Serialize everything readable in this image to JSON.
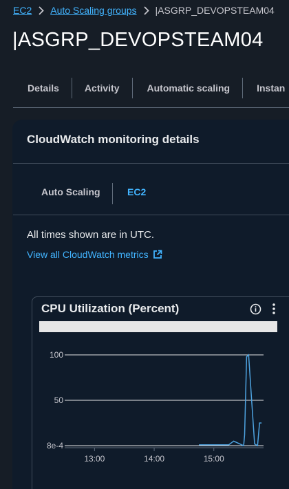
{
  "breadcrumb": {
    "items": [
      "EC2",
      "Auto Scaling groups"
    ],
    "current": "|ASGRP_DEVOPSTEAM04"
  },
  "page": {
    "title": "|ASGRP_DEVOPSTEAM04"
  },
  "tabs": [
    {
      "label": "Details"
    },
    {
      "label": "Activity"
    },
    {
      "label": "Automatic scaling"
    },
    {
      "label": "Instan"
    }
  ],
  "panel": {
    "header": "CloudWatch monitoring details",
    "tabs": [
      {
        "label": "Auto Scaling",
        "selected": false
      },
      {
        "label": "EC2",
        "selected": true
      }
    ],
    "utc_note": "All times shown are in UTC.",
    "metrics_link": "View all CloudWatch metrics",
    "external_link_icon": "external-link-icon"
  },
  "widget": {
    "title": "CPU Utilization (Percent)",
    "info_icon": "info-icon",
    "menu_icon": "vertical-ellipsis-icon"
  },
  "colors": {
    "background": "#161d26",
    "link": "#42b4ff",
    "series_line": "#4ea3e0"
  },
  "chart_data": {
    "type": "line",
    "title": "CPU Utilization (Percent)",
    "xlabel": "",
    "ylabel": "",
    "x_ticks": [
      "13:00",
      "14:00",
      "15:00"
    ],
    "y_ticks": [
      "100",
      "50",
      "8e-4"
    ],
    "ylim": [
      0.0008,
      100
    ],
    "grid": true,
    "series": [
      {
        "x": [
          "14:45",
          "14:50",
          "15:00",
          "15:05",
          "15:15",
          "15:20",
          "15:28",
          "15:30",
          "15:31",
          "15:33",
          "15:35",
          "15:38",
          "15:41",
          "15:44",
          "15:46",
          "15:48"
        ],
        "values": [
          1,
          1,
          1,
          1,
          1,
          5,
          1,
          0.0008,
          12,
          98,
          100,
          50,
          2,
          0.0008,
          25,
          25
        ]
      }
    ]
  }
}
